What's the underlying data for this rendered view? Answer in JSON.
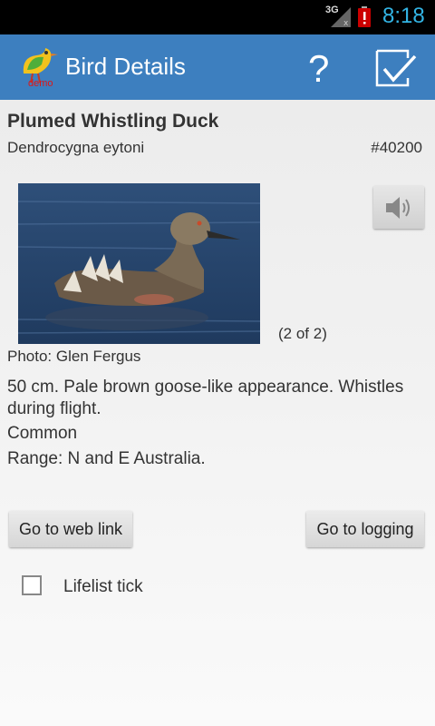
{
  "status_bar": {
    "network": "3G",
    "time": "8:18",
    "time_color": "#33b5e5"
  },
  "action_bar": {
    "title": "Bird Details",
    "logo_badge": "demo",
    "background": "#3d7fbf",
    "icons": [
      "app-logo-icon",
      "help-icon",
      "checklist-icon"
    ]
  },
  "bird": {
    "name": "Plumed Whistling Duck",
    "scientific_name": "Dendrocygna eytoni",
    "id": "#40200",
    "photo_count": "(2 of 2)",
    "photo_credit": "Photo: Glen Fergus",
    "description": "50 cm. Pale brown goose-like appearance.  Whistles during flight.",
    "status": "Common",
    "range": "Range: N and E Australia."
  },
  "buttons": {
    "web_link": "Go to web link",
    "logging": "Go to logging",
    "sound_icon": "speaker-icon"
  },
  "lifelist": {
    "label": "Lifelist tick",
    "checked": false
  }
}
